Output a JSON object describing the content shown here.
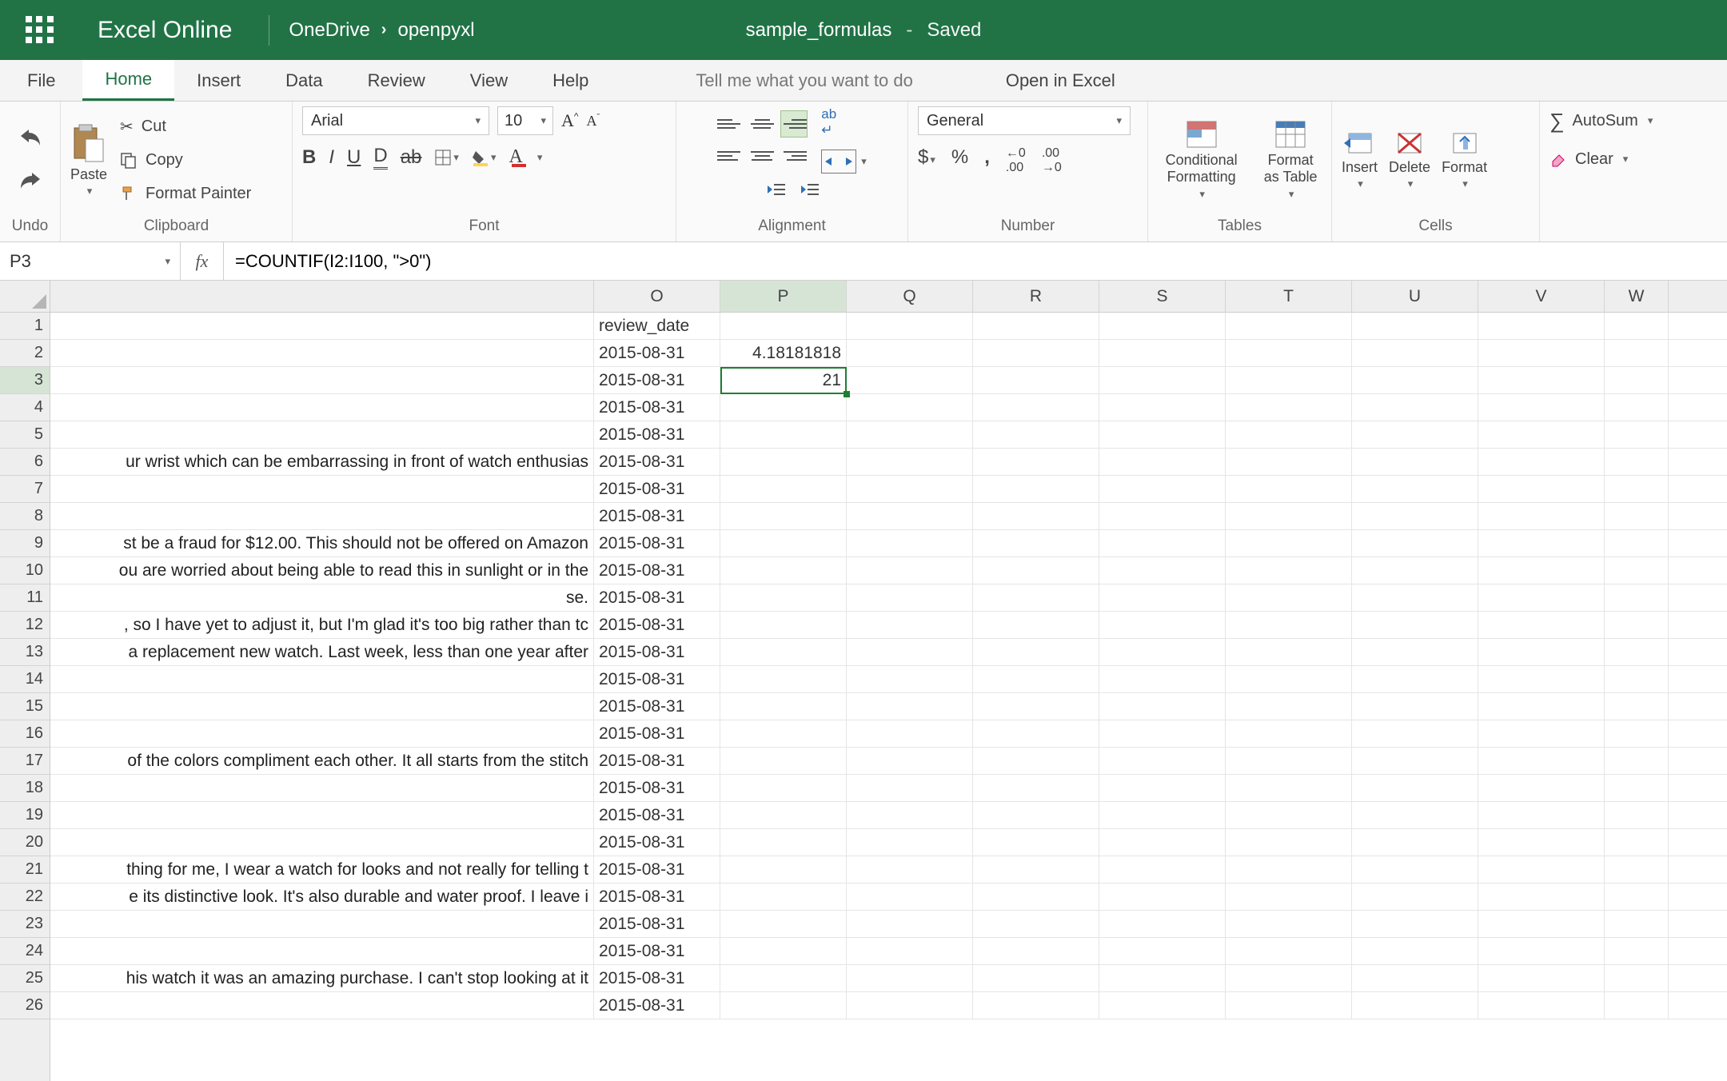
{
  "title": {
    "app": "Excel Online",
    "breadcrumb": [
      "OneDrive",
      "openpyxl"
    ],
    "doc": "sample_formulas",
    "saved": "Saved"
  },
  "tabs": {
    "file": "File",
    "home": "Home",
    "insert": "Insert",
    "data": "Data",
    "review": "Review",
    "view": "View",
    "help": "Help",
    "tellme": "Tell me what you want to do",
    "open_excel": "Open in Excel"
  },
  "ribbon": {
    "undo_label": "Undo",
    "clipboard_label": "Clipboard",
    "font_label": "Font",
    "alignment_label": "Alignment",
    "number_label": "Number",
    "tables_label": "Tables",
    "cells_label": "Cells",
    "paste": "Paste",
    "cut": "Cut",
    "copy": "Copy",
    "format_painter": "Format Painter",
    "font_name": "Arial",
    "font_size": "10",
    "number_format": "General",
    "conditional_formatting": "Conditional Formatting",
    "format_as_table": "Format as Table",
    "insert": "Insert",
    "delete": "Delete",
    "format": "Format",
    "autosum": "AutoSum",
    "clear": "Clear"
  },
  "formula_bar": {
    "cell_ref": "P3",
    "formula": "=COUNTIF(I2:I100, \">0\")"
  },
  "columns": [
    "O",
    "P",
    "Q",
    "R",
    "S",
    "T",
    "U",
    "V",
    "W"
  ],
  "selected_col": "P",
  "selected_row": 3,
  "rows": [
    {
      "n": 1,
      "pre": "",
      "O": "review_date",
      "P": ""
    },
    {
      "n": 2,
      "pre": "",
      "O": "2015-08-31",
      "P": "4.18181818"
    },
    {
      "n": 3,
      "pre": "",
      "O": "2015-08-31",
      "P": "21"
    },
    {
      "n": 4,
      "pre": "",
      "O": "2015-08-31",
      "P": ""
    },
    {
      "n": 5,
      "pre": "",
      "O": "2015-08-31",
      "P": ""
    },
    {
      "n": 6,
      "pre": "ur wrist which can be embarrassing in front of watch enthusias",
      "O": "2015-08-31",
      "P": ""
    },
    {
      "n": 7,
      "pre": "",
      "O": "2015-08-31",
      "P": ""
    },
    {
      "n": 8,
      "pre": "",
      "O": "2015-08-31",
      "P": ""
    },
    {
      "n": 9,
      "pre": "st be a fraud for $12.00. This should not be offered on Amazon",
      "O": "2015-08-31",
      "P": ""
    },
    {
      "n": 10,
      "pre": "ou are worried about being able to read this in sunlight or in the",
      "O": "2015-08-31",
      "P": ""
    },
    {
      "n": 11,
      "pre": "se.",
      "O": "2015-08-31",
      "P": ""
    },
    {
      "n": 12,
      "pre": ", so I have yet to adjust it, but I'm glad it's too big rather than tc",
      "O": "2015-08-31",
      "P": ""
    },
    {
      "n": 13,
      "pre": "a replacement new watch. Last week, less than one year after",
      "O": "2015-08-31",
      "P": ""
    },
    {
      "n": 14,
      "pre": "",
      "O": "2015-08-31",
      "P": ""
    },
    {
      "n": 15,
      "pre": "",
      "O": "2015-08-31",
      "P": ""
    },
    {
      "n": 16,
      "pre": "",
      "O": "2015-08-31",
      "P": ""
    },
    {
      "n": 17,
      "pre": "of the colors compliment each other. It all starts from the stitch",
      "O": "2015-08-31",
      "P": ""
    },
    {
      "n": 18,
      "pre": "",
      "O": "2015-08-31",
      "P": ""
    },
    {
      "n": 19,
      "pre": "",
      "O": "2015-08-31",
      "P": ""
    },
    {
      "n": 20,
      "pre": "",
      "O": "2015-08-31",
      "P": ""
    },
    {
      "n": 21,
      "pre": "thing for me, I wear a watch for looks and not really for telling t",
      "O": "2015-08-31",
      "P": ""
    },
    {
      "n": 22,
      "pre": "e its distinctive look. It's also durable and water proof. I leave i",
      "O": "2015-08-31",
      "P": ""
    },
    {
      "n": 23,
      "pre": "",
      "O": "2015-08-31",
      "P": ""
    },
    {
      "n": 24,
      "pre": "",
      "O": "2015-08-31",
      "P": ""
    },
    {
      "n": 25,
      "pre": "his watch it was an amazing purchase. I can't stop looking at it",
      "O": "2015-08-31",
      "P": ""
    },
    {
      "n": 26,
      "pre": "",
      "O": "2015-08-31",
      "P": ""
    }
  ]
}
